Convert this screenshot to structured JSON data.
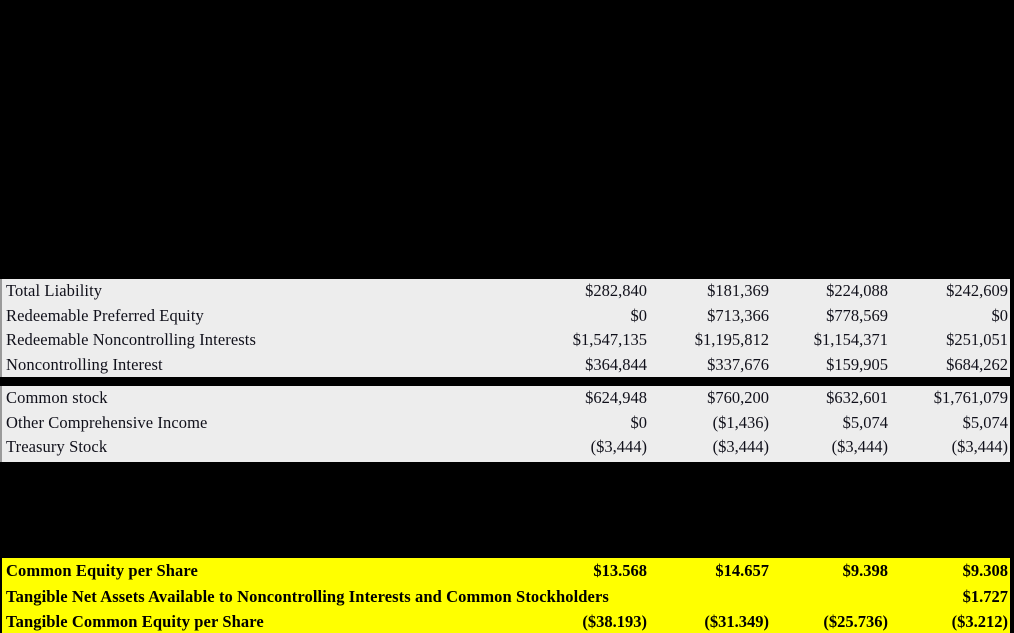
{
  "document": {
    "type": "financial-statement-excerpt",
    "background_color": "#000000",
    "table_background_color": "#ededed",
    "highlight_color": "#ffff00"
  },
  "sections": {
    "liabilities": {
      "rows": [
        {
          "label": "Total Liability",
          "values": [
            "$282,840",
            "$181,369",
            "$224,088",
            "$242,609"
          ]
        },
        {
          "label": "Redeemable Preferred Equity",
          "values": [
            "$0",
            "$713,366",
            "$778,569",
            "$0"
          ]
        },
        {
          "label": "Redeemable Noncontrolling Interests",
          "values": [
            "$1,547,135",
            "$1,195,812",
            "$1,154,371",
            "$251,051"
          ]
        },
        {
          "label": "Noncontrolling Interest",
          "values": [
            "$364,844",
            "$337,676",
            "$159,905",
            "$684,262"
          ]
        }
      ]
    },
    "equity": {
      "rows": [
        {
          "label": "Common stock",
          "values": [
            "$624,948",
            "$760,200",
            "$632,601",
            "$1,761,079"
          ]
        },
        {
          "label": "Other Comprehensive Income",
          "values": [
            "$0",
            "($1,436)",
            "$5,074",
            "$5,074"
          ]
        },
        {
          "label": "Treasury Stock",
          "values": [
            "($3,444)",
            "($3,444)",
            "($3,444)",
            "($3,444)"
          ]
        }
      ]
    },
    "per_share": {
      "rows": [
        {
          "label": "Common Equity per Share",
          "values": [
            "$13.568",
            "$14.657",
            "$9.398",
            "$9.308"
          ]
        },
        {
          "label": "Tangible Net Assets Available to Noncontrolling Interests and Common Stockholders",
          "values": [
            "",
            "",
            "",
            "$1.727"
          ]
        },
        {
          "label": "Tangible Common Equity per Share",
          "values": [
            "($38.193)",
            "($31.349)",
            "($25.736)",
            "($3.212)"
          ]
        }
      ]
    }
  }
}
